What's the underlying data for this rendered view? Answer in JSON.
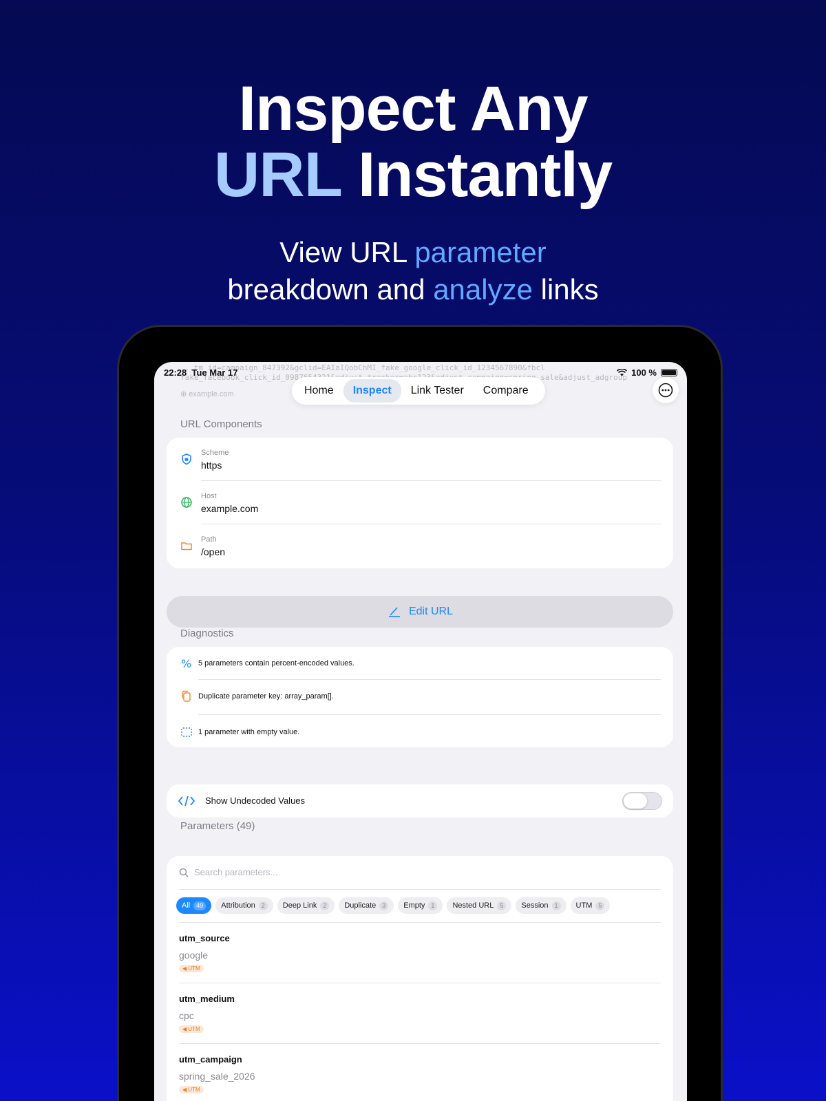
{
  "hero": {
    "line1": "Inspect Any",
    "line2_accent": "URL",
    "line2_rest": " Instantly",
    "sub_a": "View URL ",
    "sub_b": "parameter",
    "sub_c": "breakdown and ",
    "sub_d": "analyze",
    "sub_e": " links"
  },
  "status": {
    "time": "22:28",
    "date": "Tue Mar 17",
    "battery": "100 %"
  },
  "ghost": {
    "url_line1": "...tm_id=campaign_847392&gclid=EAIaIQobChMI_fake_google_click_id_1234567890&fbcl",
    "url_line2": "fake_facebook_click_id_0987654321&adjust_tracker=abc123&adjust_campaign=spring_sale&adjust_adgroup",
    "host": "example.com"
  },
  "nav": {
    "tabs": [
      "Home",
      "Inspect",
      "Link Tester",
      "Compare"
    ],
    "active": "Inspect"
  },
  "components": {
    "title": "URL Components",
    "rows": [
      {
        "label": "Scheme",
        "value": "https"
      },
      {
        "label": "Host",
        "value": "example.com"
      },
      {
        "label": "Path",
        "value": "/open"
      }
    ]
  },
  "edit_label": "Edit URL",
  "diagnostics": {
    "title": "Diagnostics",
    "rows": [
      "5 parameters contain percent-encoded values.",
      "Duplicate parameter key: array_param[].",
      "1 parameter with empty value."
    ]
  },
  "toggle": {
    "label": "Show Undecoded Values",
    "on": false
  },
  "parameters": {
    "title": "Parameters (49)",
    "search_placeholder": "Search parameters...",
    "filters": [
      {
        "label": "All",
        "count": "49"
      },
      {
        "label": "Attribution",
        "count": "2"
      },
      {
        "label": "Deep Link",
        "count": "2"
      },
      {
        "label": "Duplicate",
        "count": "3"
      },
      {
        "label": "Empty",
        "count": "1"
      },
      {
        "label": "Nested URL",
        "count": "5"
      },
      {
        "label": "Session",
        "count": "1"
      },
      {
        "label": "UTM",
        "count": "5"
      }
    ],
    "items": [
      {
        "key": "utm_source",
        "value": "google",
        "tag": "UTM"
      },
      {
        "key": "utm_medium",
        "value": "cpc",
        "tag": "UTM"
      },
      {
        "key": "utm_campaign",
        "value": "spring_sale_2026",
        "tag": "UTM"
      }
    ]
  },
  "colors": {
    "accent": "#1e88ff",
    "hero_accent": "#a6ccff",
    "hero_highlight": "#62a8ff",
    "tag": "#f07a2a"
  }
}
